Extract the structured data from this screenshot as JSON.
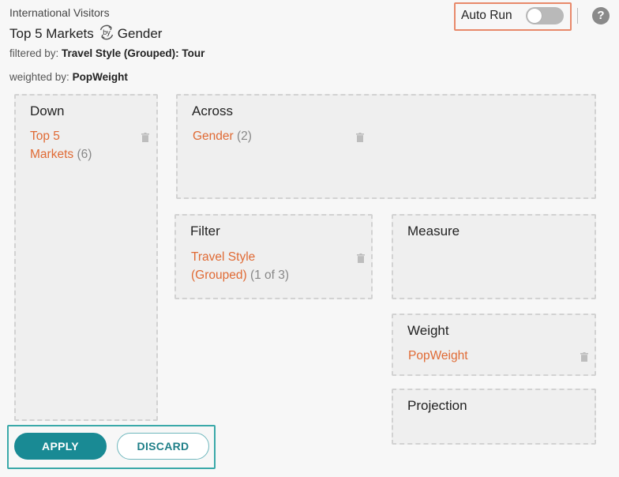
{
  "header": {
    "dataset": "International Visitors",
    "title_left": "Top 5 Markets",
    "title_connector": "by",
    "title_right": "Gender",
    "filtered_prefix": "filtered by:",
    "filtered_value": "Travel Style (Grouped): Tour",
    "weighted_prefix": "weighted by:",
    "weighted_value": "PopWeight"
  },
  "controls": {
    "auto_run_label": "Auto Run",
    "auto_run_on": false,
    "help_label": "?"
  },
  "zones": {
    "down": {
      "title": "Down",
      "item_name_line1": "Top 5",
      "item_name_line2": "Markets",
      "item_count": "(6)"
    },
    "across": {
      "title": "Across",
      "item_name": "Gender",
      "item_count": "(2)"
    },
    "filter": {
      "title": "Filter",
      "item_name_line1": "Travel Style",
      "item_name_line2": "(Grouped)",
      "item_count": "(1 of 3)"
    },
    "measure": {
      "title": "Measure"
    },
    "weight": {
      "title": "Weight",
      "item_name": "PopWeight"
    },
    "projection": {
      "title": "Projection"
    }
  },
  "actions": {
    "apply": "APPLY",
    "discard": "DISCARD"
  },
  "colors": {
    "accent_orange": "#e06a34",
    "teal": "#198a94",
    "highlight_orange": "#e8896a",
    "highlight_teal": "#3aa9a9"
  }
}
